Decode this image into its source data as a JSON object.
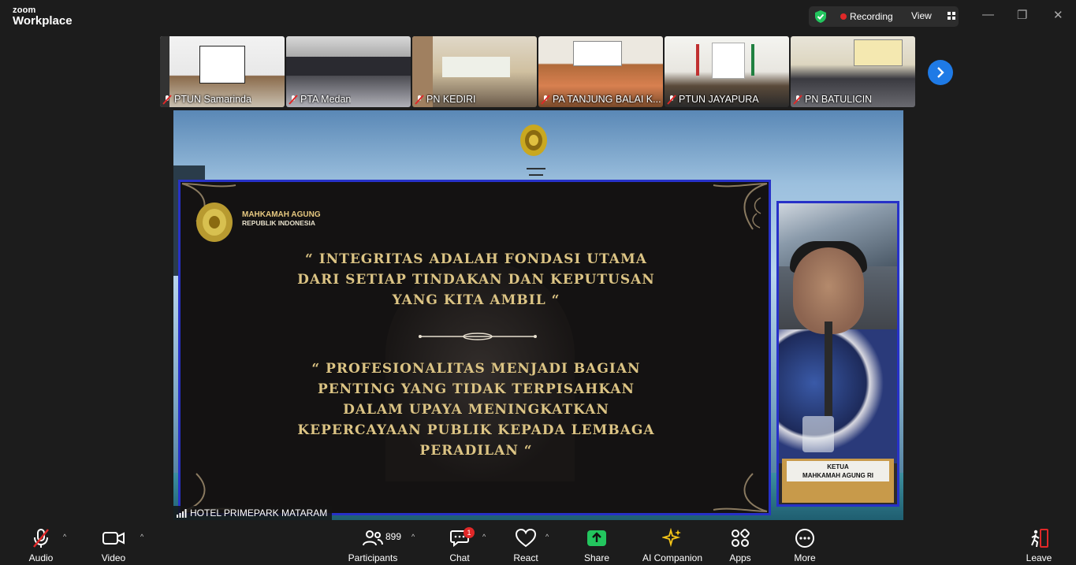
{
  "app": {
    "brand_top": "zoom",
    "brand_bottom": "Workplace"
  },
  "topbar": {
    "recording_label": "Recording",
    "view_label": "View"
  },
  "thumbnails": [
    {
      "name": "PTUN Samarinda"
    },
    {
      "name": "PTA Medan"
    },
    {
      "name": "PN KEDIRI"
    },
    {
      "name": "PA TANJUNG BALAI K..."
    },
    {
      "name": "PTUN JAYAPURA"
    },
    {
      "name": "PN BATULICIN"
    }
  ],
  "share": {
    "institution_line1": "MAHKAMAH AGUNG",
    "institution_line2": "REPUBLIK INDONESIA",
    "quote1": [
      "“ INTEGRITAS ADALAH FONDASI UTAMA",
      "DARI SETIAP TINDAKAN DAN KEPUTUSAN",
      "YANG KITA AMBIL “"
    ],
    "quote2": [
      "“ PROFESIONALITAS MENJADI BAGIAN",
      "PENTING YANG TIDAK TERPISAHKAN",
      "DALAM UPAYA MENINGKATKAN",
      "KEPERCAYAAN PUBLIK KEPADA LEMBAGA",
      "PERADILAN “"
    ],
    "plaque_line1": "KETUA",
    "plaque_line2": "MAHKAMAH AGUNG RI",
    "presenter_name": "HOTEL PRIMEPARK MATARAM"
  },
  "toolbar": {
    "audio": "Audio",
    "video": "Video",
    "participants": "Participants",
    "participants_count": "899",
    "chat": "Chat",
    "chat_badge": "1",
    "react": "React",
    "share": "Share",
    "ai_companion": "AI Companion",
    "apps": "Apps",
    "more": "More",
    "leave": "Leave"
  },
  "colors": {
    "accent_blue": "#1e7ae6",
    "share_green": "#23c55e",
    "record_red": "#e02828",
    "slide_border": "#2731c8",
    "gold_text": "#dcc484"
  }
}
